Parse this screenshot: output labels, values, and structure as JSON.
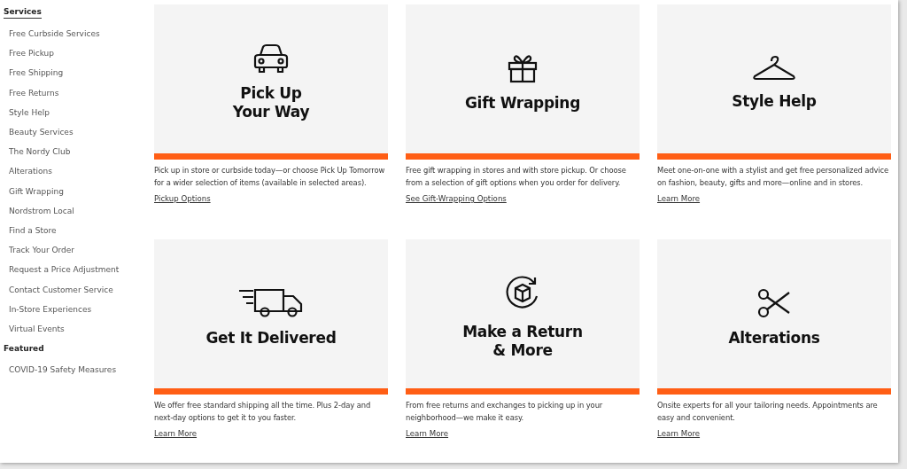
{
  "sidebar": {
    "sections": [
      {
        "heading": "Services",
        "selected": true,
        "items": [
          "Free Curbside Services",
          "Free Pickup",
          "Free Shipping",
          "Free Returns",
          "Style Help",
          "Beauty Services",
          "The Nordy Club",
          "Alterations",
          "Gift Wrapping",
          "Nordstrom Local",
          "Find a Store",
          "Track Your Order",
          "Request a Price Adjustment",
          "Contact Customer Service",
          "In-Store Experiences",
          "Virtual Events"
        ]
      },
      {
        "heading": "Featured",
        "selected": false,
        "items": [
          "COVID-19 Safety Measures"
        ]
      }
    ]
  },
  "cards": [
    {
      "title": "Pick Up\nYour Way",
      "text": "Pick up in store or curbside today—or choose Pick Up Tomorrow for a wider selection of items (available in selected areas).",
      "link": "Pickup Options"
    },
    {
      "title": "Gift Wrapping",
      "text": "Free gift wrapping in stores and with store pickup. Or choose from a selection of gift options when you order for delivery.",
      "link": "See Gift-Wrapping Options"
    },
    {
      "title": "Style Help",
      "text": "Meet one-on-one with a stylist and get free personalized advice on fashion, beauty, gifts and more—online and in stores.",
      "link": "Learn More"
    },
    {
      "title": "Get It Delivered",
      "text": "We offer free standard shipping all the time. Plus 2-day and next-day options to get it to you faster.",
      "link": "Learn More"
    },
    {
      "title": "Make a Return\n& More",
      "text": "From free returns and exchanges to picking up in your neighborhood—we make it easy.",
      "link": "Learn More"
    },
    {
      "title": "Alterations",
      "text": "Onsite experts for all your tailoring needs. Appointments are easy and convenient.",
      "link": "Learn More"
    }
  ]
}
